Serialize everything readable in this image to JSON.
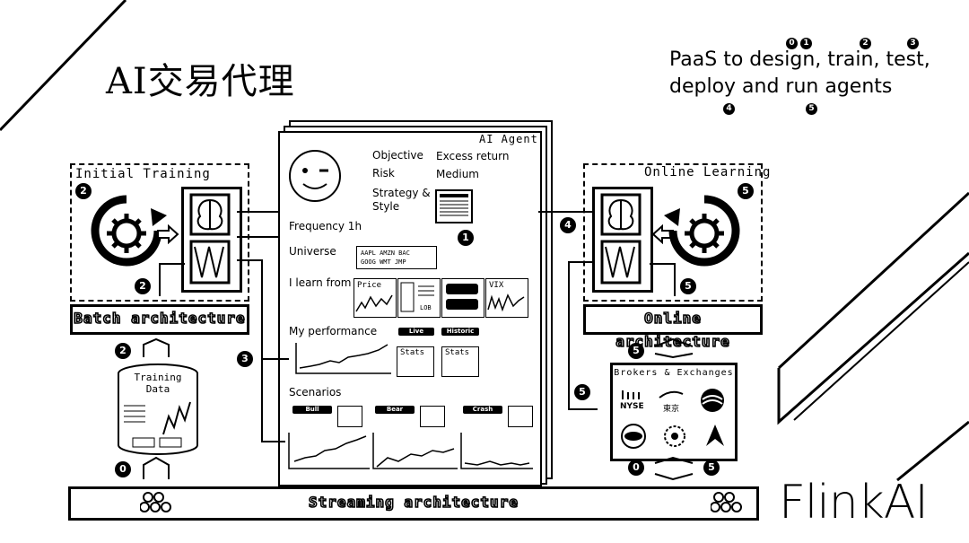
{
  "title": "AI交易代理",
  "paas": {
    "line1": "PaaS to design, train, test,",
    "line2": "deploy and run agents",
    "badges": [
      "0",
      "1",
      "2",
      "3",
      "4",
      "5"
    ]
  },
  "initial_training": {
    "label": "Initial Training",
    "bar": "Batch architecture",
    "badges": [
      "2",
      "2",
      "2",
      "0"
    ]
  },
  "training_data": {
    "label1": "Training",
    "label2": "Data"
  },
  "online_learning": {
    "label": "Online Learning",
    "bar": "Online architecture",
    "badges": [
      "5",
      "5",
      "5",
      "5",
      "0",
      "5",
      "4"
    ]
  },
  "brokers": {
    "label": "Brokers & Exchanges",
    "logos": [
      "NYSE",
      "東京",
      "",
      "",
      "",
      ""
    ]
  },
  "agent": {
    "label": "AI Agent",
    "objective_key": "Objective",
    "objective_val": "Excess return",
    "risk_key": "Risk",
    "risk_val": "Medium",
    "strategy_key": "Strategy &",
    "strategy_key2": "Style",
    "frequency": "Frequency 1h",
    "universe": "Universe",
    "tickers": [
      "AAPL",
      "AMZN",
      "BAC",
      "GOOG",
      "WMT",
      "JMP"
    ],
    "learn_from": "I learn from",
    "sources": [
      "Price",
      "LOB",
      "VIX"
    ],
    "performance": "My performance",
    "live": "Live",
    "historic": "Historic",
    "stats": "Stats",
    "scenarios": "Scenarios",
    "scenario_names": [
      "Bull",
      "Bear",
      "Crash"
    ],
    "badge1": "1",
    "badge3": "3"
  },
  "streaming": {
    "bar": "Streaming architecture"
  },
  "brand": "FlinkAI"
}
